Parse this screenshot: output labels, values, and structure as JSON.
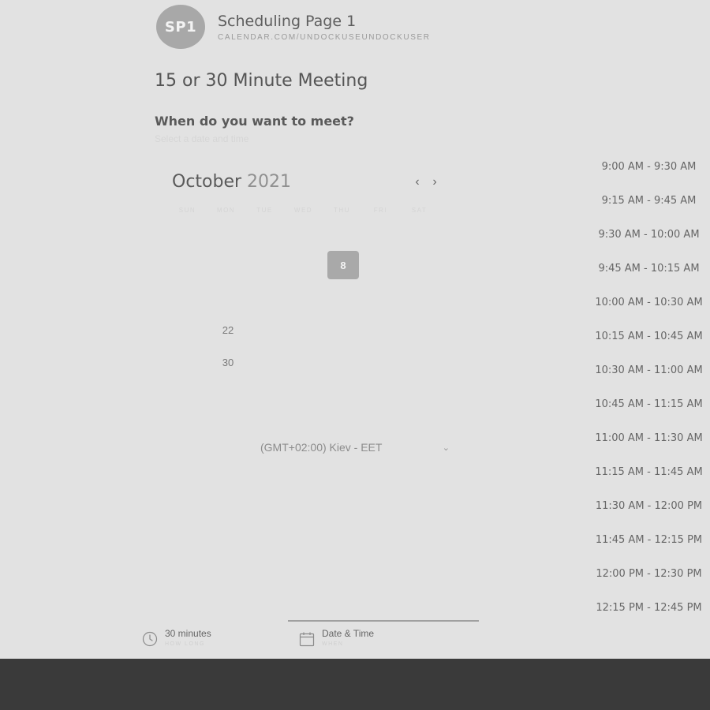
{
  "header": {
    "avatar_initials": "SP1",
    "page_name": "Scheduling Page 1",
    "url": "CALENDAR.COM/UNDOCKUSEUNDOCKUSER"
  },
  "meeting": {
    "title": "15 or 30 Minute Meeting",
    "question": "When do you want to meet?",
    "instruction": "Select a date and time"
  },
  "calendar": {
    "month": "October",
    "year": "2021",
    "prev_icon": "‹",
    "next_icon": "›",
    "weekdays": [
      "SUN",
      "MON",
      "TUE",
      "WED",
      "THU",
      "FRI",
      "SAT"
    ],
    "selected_day": "8",
    "visible_days": [
      "22",
      "30"
    ]
  },
  "timezone": {
    "label": "(GMT+02:00) Kiev - EET",
    "chevron": "⌄"
  },
  "time_slots": [
    "9:00 AM - 9:30 AM",
    "9:15 AM - 9:45 AM",
    "9:30 AM - 10:00 AM",
    "9:45 AM - 10:15 AM",
    "10:00 AM - 10:30 AM",
    "10:15 AM - 10:45 AM",
    "10:30 AM - 11:00 AM",
    "10:45 AM - 11:15 AM",
    "11:00 AM - 11:30 AM",
    "11:15 AM - 11:45 AM",
    "11:30 AM - 12:00 PM",
    "11:45 AM - 12:15 PM",
    "12:00 PM - 12:30 PM",
    "12:15 PM - 12:45 PM"
  ],
  "footer": {
    "duration": {
      "value": "30 minutes",
      "sub": "HOW LONG",
      "icon": "clock-icon"
    },
    "datetime": {
      "value": "Date & Time",
      "sub": "WHEN",
      "icon": "calendar-icon"
    }
  },
  "colors": {
    "background": "#e2e2e2",
    "accent": "#a9a9a9",
    "bottom_bar": "#3a3a3a"
  }
}
